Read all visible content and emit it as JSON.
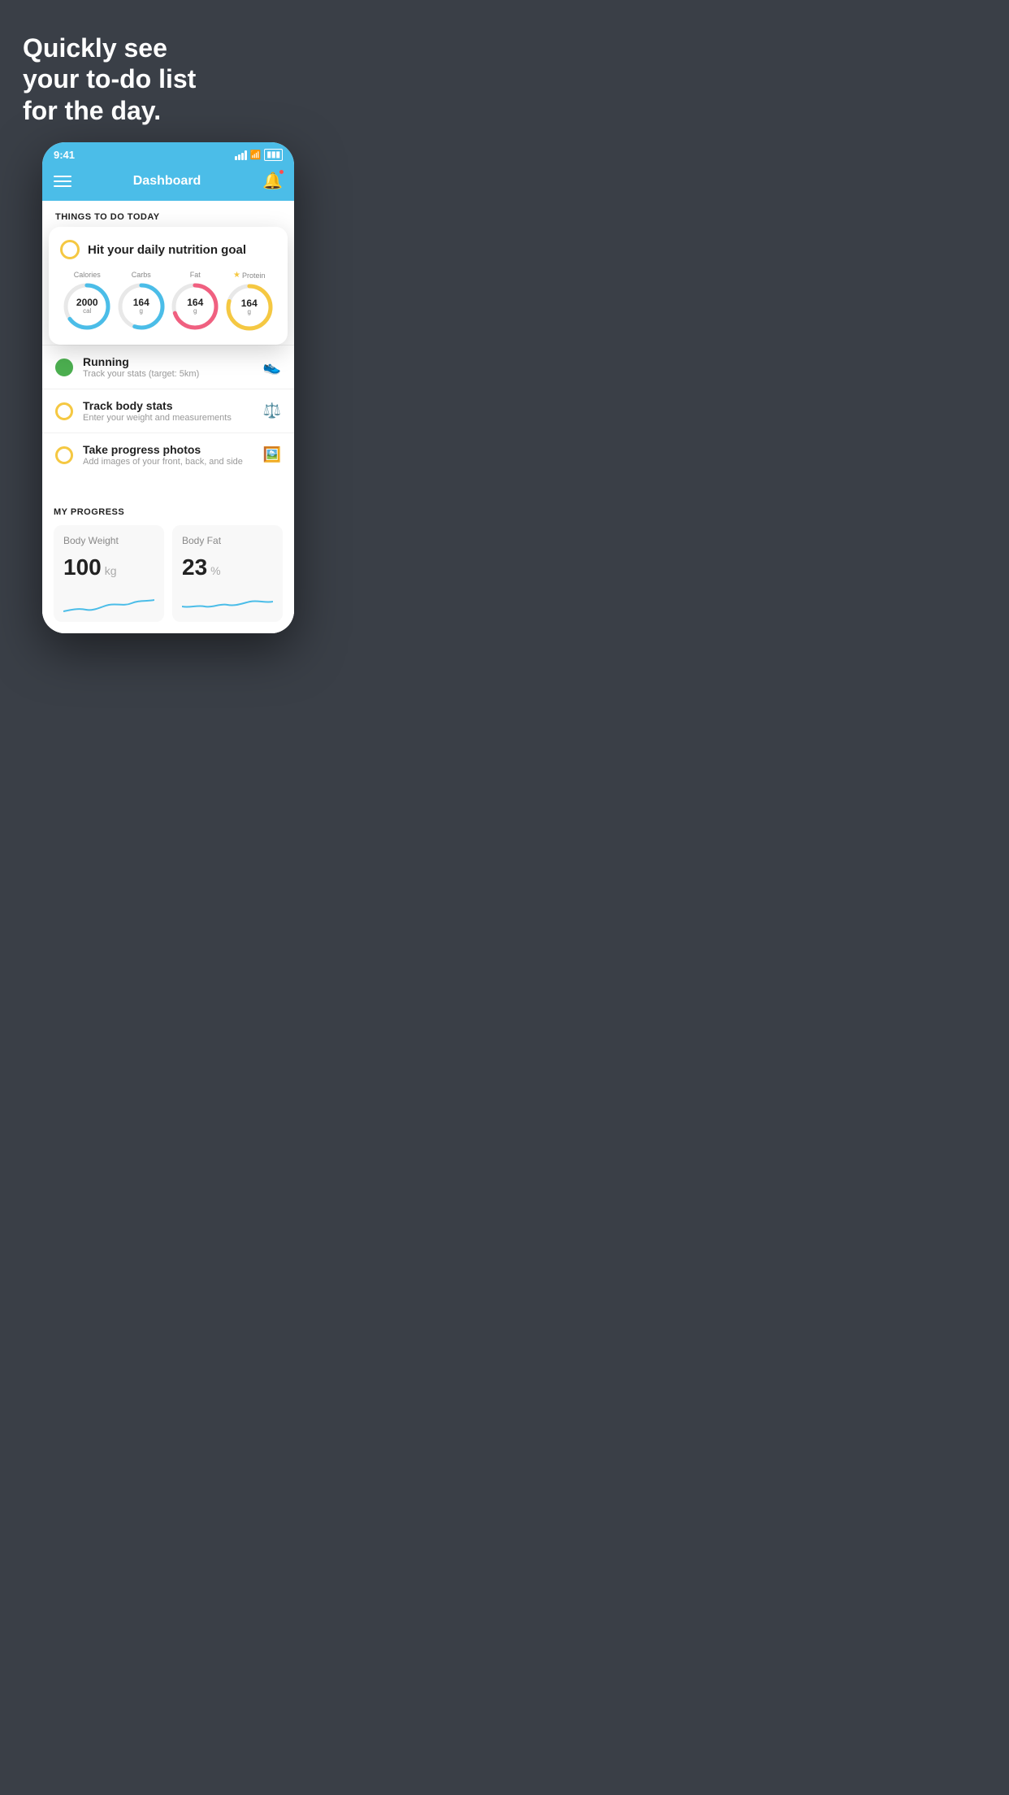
{
  "background_color": "#3a3f47",
  "hero": {
    "line1": "Quickly see",
    "line2": "your to-do list",
    "line3": "for the day."
  },
  "status_bar": {
    "time": "9:41",
    "signal": "signal",
    "wifi": "wifi",
    "battery": "battery"
  },
  "nav": {
    "title": "Dashboard",
    "menu_label": "menu",
    "bell_label": "notifications"
  },
  "section_today": {
    "header": "THINGS TO DO TODAY"
  },
  "nutrition_card": {
    "title": "Hit your daily nutrition goal",
    "items": [
      {
        "label": "Calories",
        "value": "2000",
        "unit": "cal",
        "color": "calories",
        "starred": false,
        "pct": 65
      },
      {
        "label": "Carbs",
        "value": "164",
        "unit": "g",
        "color": "carbs",
        "starred": false,
        "pct": 55
      },
      {
        "label": "Fat",
        "value": "164",
        "unit": "g",
        "color": "fat",
        "starred": false,
        "pct": 70
      },
      {
        "label": "Protein",
        "value": "164",
        "unit": "g",
        "color": "protein",
        "starred": true,
        "pct": 80
      }
    ]
  },
  "todo_items": [
    {
      "title": "Running",
      "subtitle": "Track your stats (target: 5km)",
      "icon": "shoe",
      "checked": true,
      "circle_color": "green"
    },
    {
      "title": "Track body stats",
      "subtitle": "Enter your weight and measurements",
      "icon": "scale",
      "checked": false,
      "circle_color": "yellow"
    },
    {
      "title": "Take progress photos",
      "subtitle": "Add images of your front, back, and side",
      "icon": "person",
      "checked": false,
      "circle_color": "yellow"
    }
  ],
  "progress_section": {
    "header": "MY PROGRESS",
    "cards": [
      {
        "title": "Body Weight",
        "value": "100",
        "unit": "kg"
      },
      {
        "title": "Body Fat",
        "value": "23",
        "unit": "%"
      }
    ]
  }
}
